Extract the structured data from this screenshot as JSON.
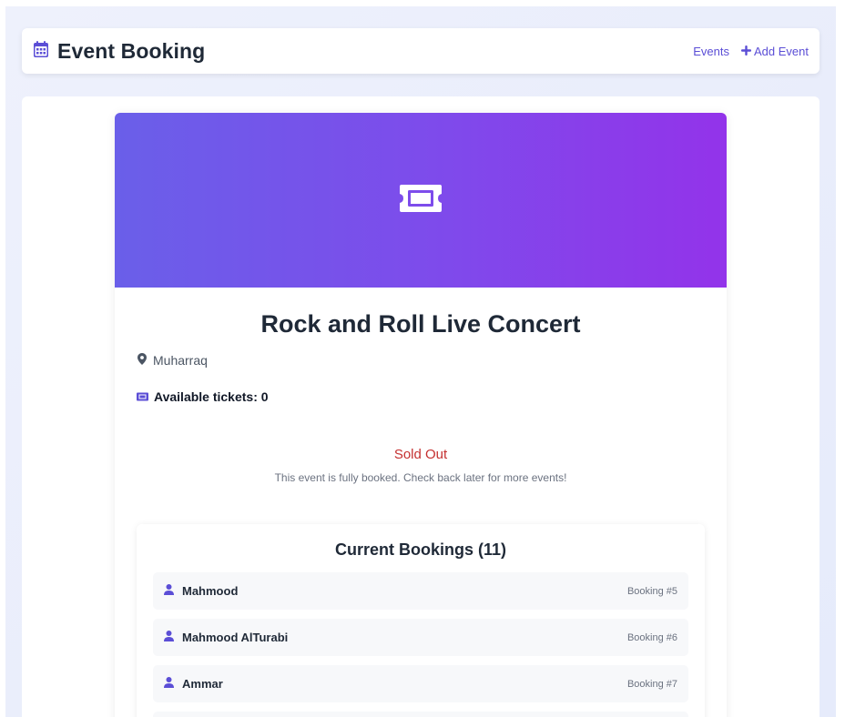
{
  "header": {
    "brand_icon": "calendar-icon",
    "title": "Event Booking",
    "nav": [
      {
        "label": "Events",
        "icon": ""
      },
      {
        "label": "Add Event",
        "icon": "plus-icon"
      }
    ]
  },
  "event": {
    "hero_icon": "ticket-icon",
    "title": "Rock and Roll Live Concert",
    "location": "Muharraq",
    "tickets_label": "Available tickets: 0",
    "status": "Sold Out",
    "status_message": "This event is fully booked. Check back later for more events!"
  },
  "bookings": {
    "title": "Current Bookings (11)",
    "items": [
      {
        "name": "Mahmood",
        "number": "Booking #5"
      },
      {
        "name": "Mahmood AlTurabi",
        "number": "Booking #6"
      },
      {
        "name": "Ammar",
        "number": "Booking #7"
      }
    ]
  },
  "colors": {
    "accent": "#5b4ed6",
    "hero_start": "#6a5fe9",
    "hero_end": "#9333ea",
    "soldout": "#c53030"
  }
}
